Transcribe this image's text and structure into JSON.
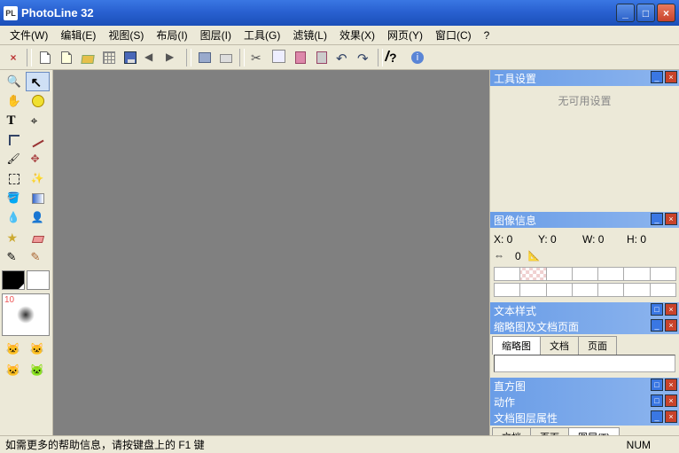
{
  "window": {
    "title": "PhotoLine 32",
    "app_icon": "PL"
  },
  "menu": {
    "items": [
      "文件(W)",
      "编辑(E)",
      "视图(S)",
      "布局(I)",
      "图层(I)",
      "工具(G)",
      "滤镜(L)",
      "效果(X)",
      "网页(Y)",
      "窗口(C)",
      "?"
    ]
  },
  "toolbox": {
    "brush_size": "10"
  },
  "panels": {
    "tool_settings": {
      "title": "工具设置",
      "no_settings": "无可用设置"
    },
    "image_info": {
      "title": "图像信息",
      "x": "X: 0",
      "y": "Y: 0",
      "w": "W: 0",
      "h": "H: 0",
      "arrow_val": "0"
    },
    "text_style": {
      "title": "文本样式",
      "sub_title": "缩略图及文档页面",
      "tabs": [
        "缩略图",
        "文档",
        "页面"
      ]
    },
    "histogram": {
      "title": "直方图"
    },
    "action": {
      "title": "动作"
    },
    "layer_attr": {
      "title": "文档图层属性",
      "tabs": [
        "文档",
        "页面",
        "图层(T)"
      ]
    }
  },
  "statusbar": {
    "hint": "如需更多的帮助信息，请按键盘上的 F1 键",
    "num": "NUM"
  }
}
